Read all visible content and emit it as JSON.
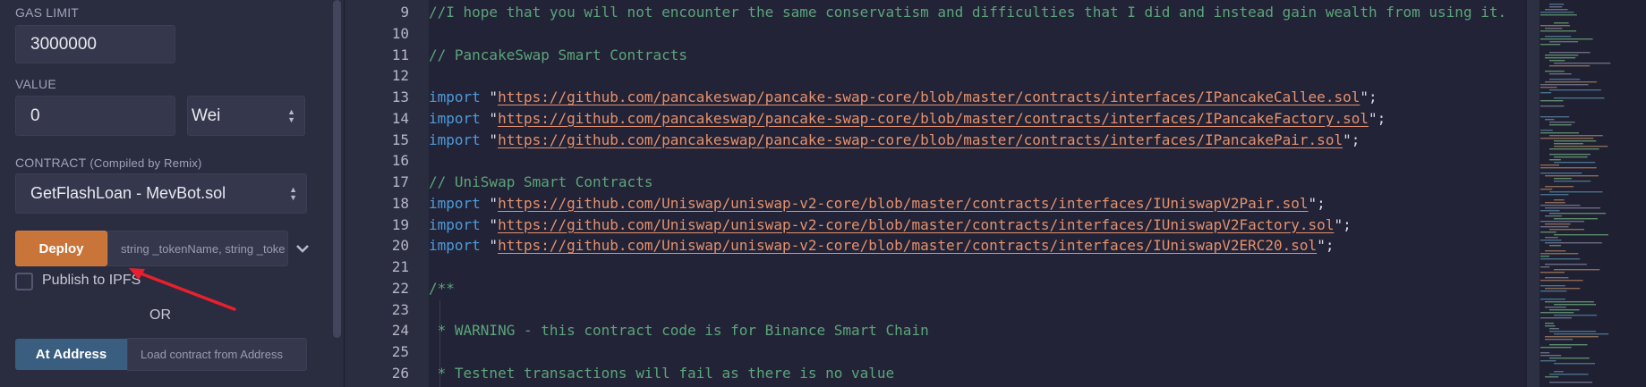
{
  "panel": {
    "gas_limit_label": "GAS LIMIT",
    "gas_limit_value": "3000000",
    "value_label": "VALUE",
    "value_amount": "0",
    "value_unit": "Wei",
    "contract_label": "CONTRACT",
    "contract_label_note": "(Compiled by Remix)",
    "contract_selected": "GetFlashLoan - MevBot.sol",
    "deploy_label": "Deploy",
    "deploy_args_placeholder": "string _tokenName, string _toke",
    "publish_label": "Publish to IPFS",
    "publish_checked": false,
    "or_label": "OR",
    "at_address_label": "At Address",
    "at_address_placeholder": "Load contract from Address"
  },
  "colors": {
    "deploy_button": "#c97539",
    "at_address_button": "#3a5e7f",
    "annotation_arrow": "#e8202e",
    "comment": "#5ba57a",
    "keyword": "#4e9bdc",
    "string": "#e6916c"
  },
  "icons": {
    "deploy_caret": "chevron-down-icon",
    "select_arrows": "up-down-arrows-icon",
    "annotation": "red-arrow-annotation"
  },
  "editor": {
    "lines": [
      {
        "num": "9",
        "tokens": [
          {
            "t": "comment",
            "v": "//I hope that you will not encounter the same conservatism and difficulties that I did and instead gain wealth from using it."
          }
        ]
      },
      {
        "num": "10",
        "tokens": []
      },
      {
        "num": "11",
        "tokens": [
          {
            "t": "comment",
            "v": "// PancakeSwap Smart Contracts"
          }
        ]
      },
      {
        "num": "12",
        "tokens": []
      },
      {
        "num": "13",
        "tokens": [
          {
            "t": "kw",
            "v": "import"
          },
          {
            "t": "plain",
            "v": " \""
          },
          {
            "t": "str",
            "v": "https://github.com/pancakeswap/pancake-swap-core/blob/master/contracts/interfaces/IPancakeCallee.sol"
          },
          {
            "t": "plain",
            "v": "\";"
          }
        ]
      },
      {
        "num": "14",
        "tokens": [
          {
            "t": "kw",
            "v": "import"
          },
          {
            "t": "plain",
            "v": " \""
          },
          {
            "t": "str",
            "v": "https://github.com/pancakeswap/pancake-swap-core/blob/master/contracts/interfaces/IPancakeFactory.sol"
          },
          {
            "t": "plain",
            "v": "\";"
          }
        ]
      },
      {
        "num": "15",
        "tokens": [
          {
            "t": "kw",
            "v": "import"
          },
          {
            "t": "plain",
            "v": " \""
          },
          {
            "t": "str",
            "v": "https://github.com/pancakeswap/pancake-swap-core/blob/master/contracts/interfaces/IPancakePair.sol"
          },
          {
            "t": "plain",
            "v": "\";"
          }
        ]
      },
      {
        "num": "16",
        "tokens": []
      },
      {
        "num": "17",
        "tokens": [
          {
            "t": "comment",
            "v": "// UniSwap Smart Contracts"
          }
        ]
      },
      {
        "num": "18",
        "tokens": [
          {
            "t": "kw",
            "v": "import"
          },
          {
            "t": "plain",
            "v": " \""
          },
          {
            "t": "str",
            "v": "https://github.com/Uniswap/uniswap-v2-core/blob/master/contracts/interfaces/IUniswapV2Pair.sol"
          },
          {
            "t": "plain",
            "v": "\";"
          }
        ]
      },
      {
        "num": "19",
        "tokens": [
          {
            "t": "kw",
            "v": "import"
          },
          {
            "t": "plain",
            "v": " \""
          },
          {
            "t": "str",
            "v": "https://github.com/Uniswap/uniswap-v2-core/blob/master/contracts/interfaces/IUniswapV2Factory.sol"
          },
          {
            "t": "plain",
            "v": "\";"
          }
        ]
      },
      {
        "num": "20",
        "tokens": [
          {
            "t": "kw",
            "v": "import"
          },
          {
            "t": "plain",
            "v": " \""
          },
          {
            "t": "str",
            "v": "https://github.com/Uniswap/uniswap-v2-core/blob/master/contracts/interfaces/IUniswapV2ERC20.sol"
          },
          {
            "t": "plain",
            "v": "\";"
          }
        ]
      },
      {
        "num": "21",
        "tokens": []
      },
      {
        "num": "22",
        "tokens": [
          {
            "t": "comment",
            "v": "/**"
          }
        ]
      },
      {
        "num": "23",
        "tokens": []
      },
      {
        "num": "24",
        "tokens": [
          {
            "t": "comment",
            "v": " * WARNING - this contract code is for Binance Smart Chain"
          }
        ]
      },
      {
        "num": "25",
        "tokens": []
      },
      {
        "num": "26",
        "tokens": [
          {
            "t": "comment",
            "v": " * Testnet transactions will fail as there is no value"
          }
        ]
      }
    ]
  }
}
